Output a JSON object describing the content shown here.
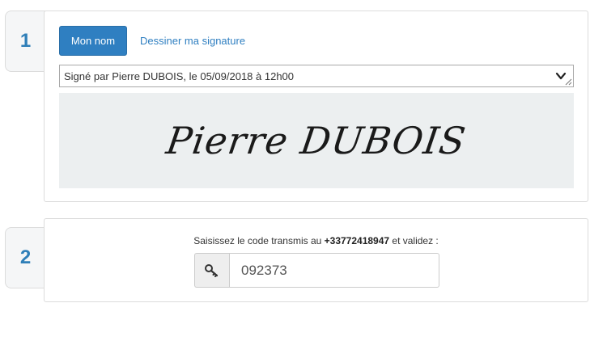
{
  "step1": {
    "number": "1",
    "tab_active_label": "Mon nom",
    "tab_draw_label": "Dessiner ma signature",
    "signature_select_value": "Signé par Pierre DUBOIS, le 05/09/2018 à 12h00",
    "signature_preview_text": "Pierre DUBOIS"
  },
  "step2": {
    "number": "2",
    "instruction_prefix": "Saisissez le code transmis au ",
    "phone_number": "+33772418947",
    "instruction_suffix": " et validez :",
    "code_value": "092373"
  },
  "colors": {
    "accent": "#2f7fc1",
    "badge_number": "#2f7fb8",
    "preview_bg": "#eceff0"
  },
  "icons": {
    "chevron": "chevron-down-icon",
    "key": "key-icon"
  }
}
